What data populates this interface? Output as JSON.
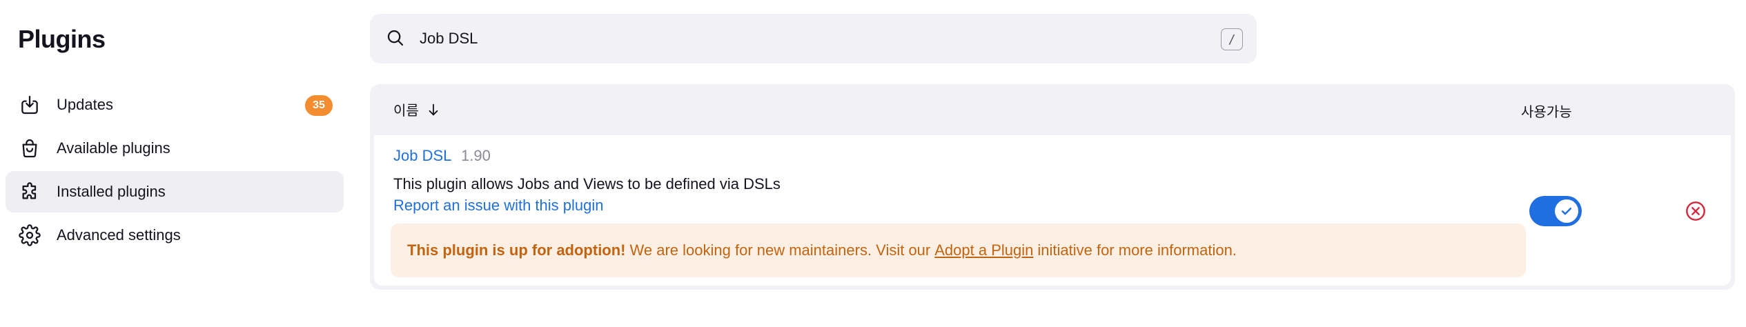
{
  "page": {
    "title": "Plugins"
  },
  "sidebar": {
    "items": [
      {
        "label": "Updates",
        "icon": "download-tray-icon",
        "badge": "35",
        "active": false
      },
      {
        "label": "Available plugins",
        "icon": "shopping-bag-icon",
        "active": false
      },
      {
        "label": "Installed plugins",
        "icon": "puzzle-piece-icon",
        "active": true
      },
      {
        "label": "Advanced settings",
        "icon": "gear-icon",
        "active": false
      }
    ]
  },
  "search": {
    "value": "Job DSL",
    "shortcut": "/"
  },
  "table": {
    "columns": {
      "name": "이름",
      "enabled": "사용가능"
    },
    "rows": [
      {
        "name": "Job DSL",
        "version": "1.90",
        "description": "This plugin allows Jobs and Views to be defined via DSLs",
        "issue_link": "Report an issue with this plugin",
        "adoption": {
          "bold": "This plugin is up for adoption!",
          "before": "We are looking for new maintainers. Visit our",
          "link": "Adopt a Plugin",
          "after": "initiative for more information."
        },
        "enabled": true
      }
    ]
  },
  "colors": {
    "accent": "#1f6fe0",
    "badge": "#f38d2f",
    "warning_bg": "#fdefe3",
    "warning_text": "#c2640f",
    "danger": "#d6263b"
  }
}
